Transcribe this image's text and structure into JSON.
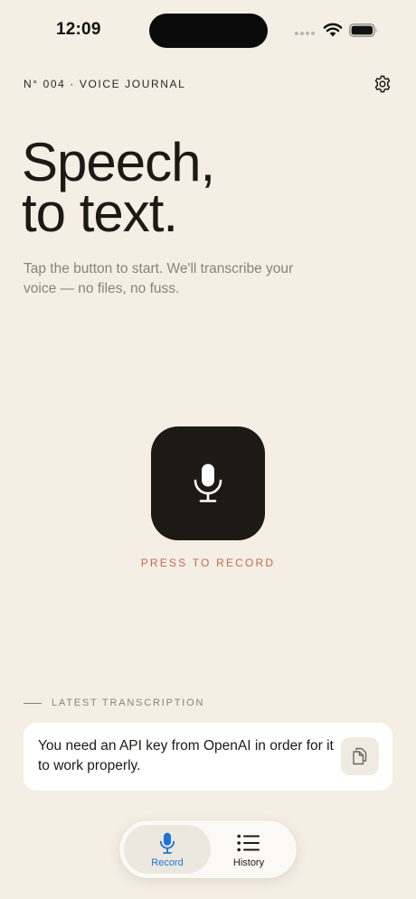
{
  "status_bar": {
    "time": "12:09"
  },
  "header": {
    "eyebrow": "N° 004 · VOICE JOURNAL",
    "settings_icon": "gear-icon"
  },
  "hero": {
    "headline_line1": "Speech,",
    "headline_line2": "to text.",
    "subtitle": "Tap the button to start. We'll transcribe your voice — no files, no fuss."
  },
  "record": {
    "icon": "microphone-icon",
    "label": "PRESS TO RECORD"
  },
  "latest": {
    "section_label": "LATEST TRANSCRIPTION",
    "text": "You need an API key from OpenAI in order for it to work properly.",
    "copy_icon": "copy-icon"
  },
  "tabs": [
    {
      "label": "Record",
      "icon": "microphone-icon",
      "active": true
    },
    {
      "label": "History",
      "icon": "list-icon",
      "active": false
    }
  ],
  "colors": {
    "background": "#f4eee5",
    "ink": "#1d1a16",
    "accent_red": "#c9674a",
    "active_tab_blue": "#1c74d8",
    "muted": "#8a8378"
  }
}
